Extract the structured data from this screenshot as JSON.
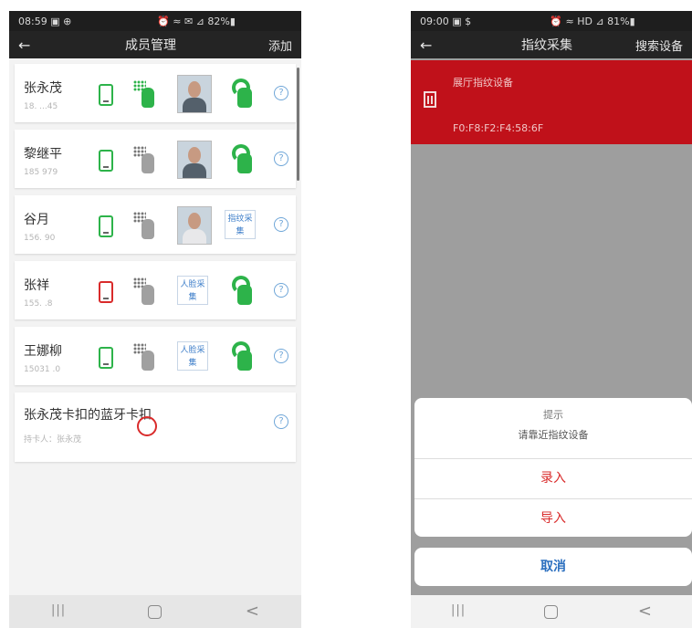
{
  "left": {
    "status": {
      "time": "08:59 ▣ ⊕",
      "icons": "⏰ ≈ ✉ ⊿ 82%▮"
    },
    "appbar": {
      "back": "←",
      "title": "成员管理",
      "action": "添加"
    },
    "members": [
      {
        "name": "张永茂",
        "phone": "18.  ...45",
        "phone_color": "green"
      },
      {
        "name": "黎继平",
        "phone": "185   979",
        "phone_color": "green"
      },
      {
        "name": "谷月",
        "phone": "156.   90",
        "phone_color": "green"
      },
      {
        "name": "张祥",
        "phone": "155.    .8",
        "phone_color": "red"
      },
      {
        "name": "王娜柳",
        "phone": "15031    .0",
        "phone_color": "green"
      }
    ],
    "finger_collect_label": "指纹采集",
    "face_collect_label": "人脸采集",
    "help": "?",
    "bt_card": {
      "name": "张永茂卡扣的蓝牙卡扣",
      "owner": "持卡人：张永茂"
    },
    "nav": {
      "back": "<"
    }
  },
  "right": {
    "status": {
      "time": "09:00 ▣ $",
      "icons": "⏰ ≈ HD ⊿ 81%▮"
    },
    "appbar": {
      "back": "←",
      "title": "指纹采集",
      "action": "搜索设备"
    },
    "device": {
      "name": "展厅指纹设备",
      "mac": "F0:F8:F2:F4:58:6F"
    },
    "sheet": {
      "title": "提示",
      "message": "请靠近指纹设备",
      "enroll": "录入",
      "import": "导入",
      "cancel": "取消"
    },
    "nav": {
      "back": "<"
    }
  },
  "colors": {
    "accent_red": "#c0111a",
    "green": "#2db34a",
    "link_blue": "#2b6fbf"
  }
}
